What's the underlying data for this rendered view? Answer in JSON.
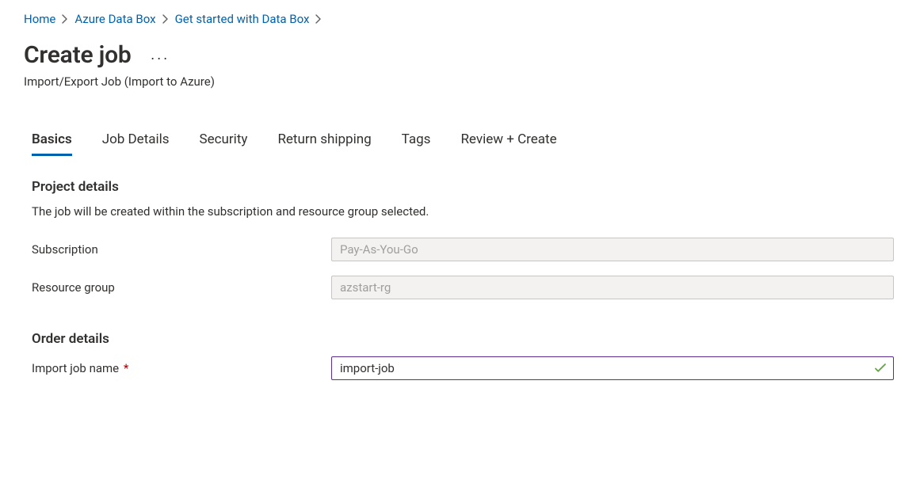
{
  "breadcrumb": {
    "items": [
      {
        "label": "Home"
      },
      {
        "label": "Azure Data Box"
      },
      {
        "label": "Get started with Data Box"
      }
    ]
  },
  "header": {
    "title": "Create job",
    "subtitle": "Import/Export Job (Import to Azure)"
  },
  "tabs": [
    {
      "label": "Basics",
      "active": true
    },
    {
      "label": "Job Details",
      "active": false
    },
    {
      "label": "Security",
      "active": false
    },
    {
      "label": "Return shipping",
      "active": false
    },
    {
      "label": "Tags",
      "active": false
    },
    {
      "label": "Review + Create",
      "active": false
    }
  ],
  "project": {
    "heading": "Project details",
    "description": "The job will be created within the subscription and resource group selected.",
    "subscription_label": "Subscription",
    "subscription_value": "Pay-As-You-Go",
    "resource_group_label": "Resource group",
    "resource_group_value": "azstart-rg"
  },
  "order": {
    "heading": "Order details",
    "job_name_label": "Import job name",
    "job_name_value": "import-job"
  }
}
